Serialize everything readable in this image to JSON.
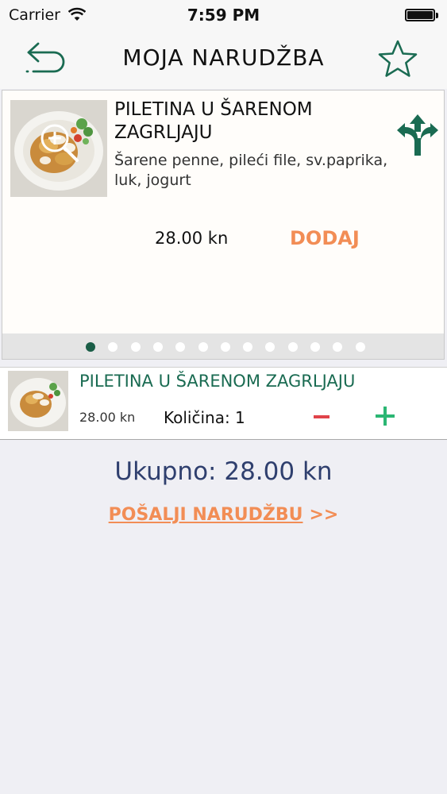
{
  "status_bar": {
    "carrier": "Carrier",
    "time": "7:59 PM",
    "battery_level": 1.0
  },
  "nav": {
    "title": "MOJA NARUDŽBA",
    "back_icon": "back-arrow-icon",
    "favorite_icon": "star-icon"
  },
  "product_card": {
    "title": "PILETINA U ŠARENOM ZAGRLJAJU",
    "description": "Šarene penne, pileći file, sv.paprika, luk, jogurt",
    "price": "28.00 kn",
    "add_label": "DODAJ",
    "zoom_icon": "zoom-in-icon",
    "variants_icon": "split-arrows-icon",
    "pager": {
      "total": 13,
      "active": 0
    }
  },
  "order": {
    "items": [
      {
        "name": "PILETINA U ŠARENOM ZAGRLJAJU",
        "price": "28.00 kn",
        "quantity_label": "Količina: 1"
      }
    ],
    "minus_icon": "minus-icon",
    "plus_icon": "plus-icon"
  },
  "summary": {
    "total": "Ukupno: 28.00 kn",
    "send_label": "POŠALJI NARUDŽBU",
    "send_arrows": ">>"
  },
  "colors": {
    "accent_green": "#1a6b52",
    "accent_orange": "#f28d55",
    "total_blue": "#2f3f6e"
  }
}
